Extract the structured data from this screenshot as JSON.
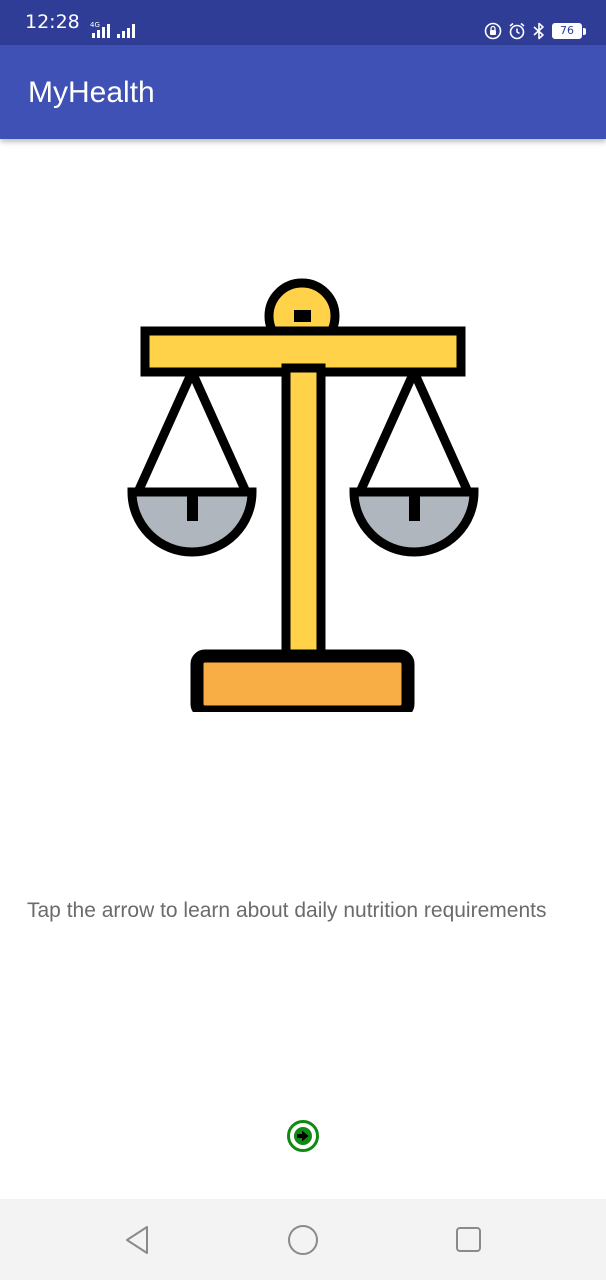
{
  "status_bar": {
    "time": "12:28",
    "network_type": "4G",
    "battery_level": "76",
    "icons": [
      "signal-icon",
      "lock-rotation-icon",
      "alarm-icon",
      "bluetooth-icon",
      "battery-icon"
    ]
  },
  "app_bar": {
    "title": "MyHealth"
  },
  "main": {
    "illustration": "balance-scale-icon",
    "instruction": "Tap the arrow to learn about daily nutrition requirements",
    "next_button_icon": "arrow-right-circle-icon"
  },
  "nav_bar": {
    "buttons": [
      "back-icon",
      "home-icon",
      "recents-icon"
    ]
  },
  "colors": {
    "status_bar": "#2f3d96",
    "app_bar": "#3f51b5",
    "scale_yellow": "#ffd24a",
    "scale_base": "#f9ae45",
    "scale_pan": "#b0b6bd",
    "arrow_green": "#118a11",
    "text_gray": "#6b6b6b"
  }
}
